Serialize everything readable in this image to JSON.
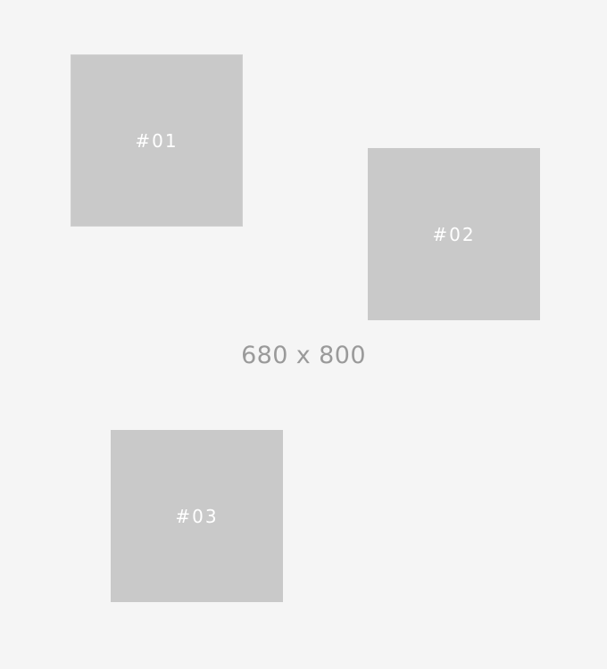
{
  "canvas": {
    "dimension_label": "680 x 800"
  },
  "boxes": [
    {
      "label": "#01"
    },
    {
      "label": "#02"
    },
    {
      "label": "#03"
    }
  ],
  "colors": {
    "background": "#f5f5f5",
    "box_fill": "#c9c9c9",
    "box_text": "#ffffff",
    "dimension_text": "#9a9a9a"
  }
}
